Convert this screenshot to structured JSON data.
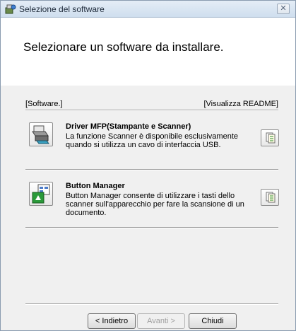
{
  "window": {
    "title": "Selezione del software",
    "close_glyph": "✕"
  },
  "heading": "Selezionare un software da installare.",
  "labels": {
    "software": "[Software.]",
    "readme": "[Visualizza README]"
  },
  "items": [
    {
      "title": "Driver MFP(Stampante e Scanner)",
      "description": "La funzione Scanner è disponibile esclusivamente quando si utilizza un cavo di interfaccia USB.",
      "icon": "printer-scanner-icon"
    },
    {
      "title": "Button Manager",
      "description": "Button Manager consente di utilizzare i tasti dello scanner sull'apparecchio per fare la scansione di un documento.",
      "icon": "button-manager-icon"
    }
  ],
  "buttons": {
    "back": "< Indietro",
    "next": "Avanti >",
    "close": "Chiudi"
  },
  "colors": {
    "accent": "#2a7d2a",
    "window_bg": "#f0f0f0"
  }
}
